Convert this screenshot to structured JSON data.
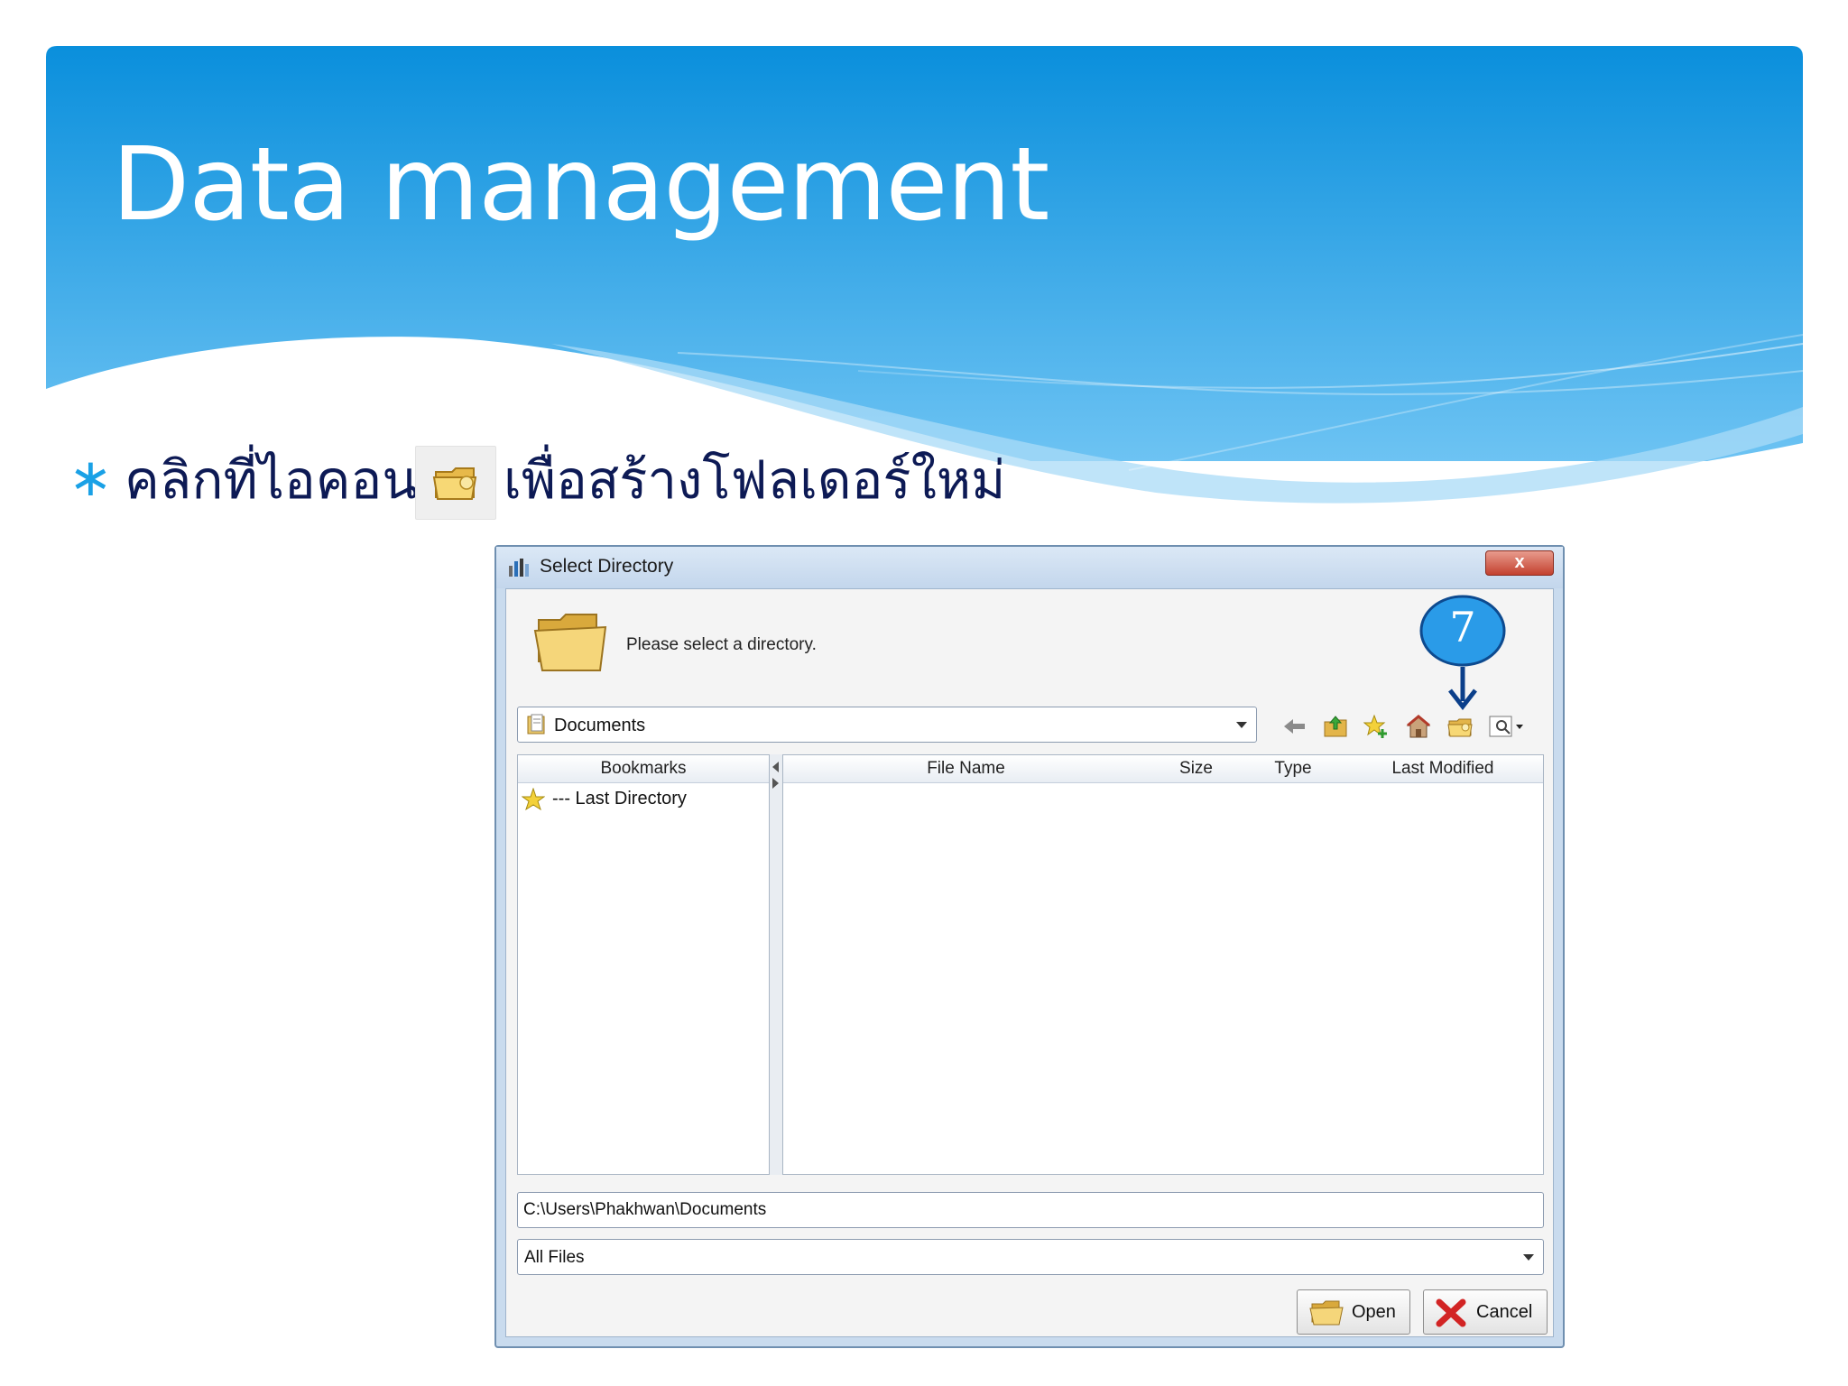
{
  "slide": {
    "title": "Data management",
    "bullet": {
      "text_before_icon": "คลิกที่ไอคอน",
      "text_after_icon": "เพื่อสร้างโฟลเดอร์ใหม่",
      "icon": "new-folder-icon"
    }
  },
  "dialog": {
    "title": "Select Directory",
    "close_label": "x",
    "prompt": "Please select a directory.",
    "step_badge": "7",
    "location": "Documents",
    "toolbar_icons": [
      "back-arrow-icon",
      "folder-up-icon",
      "add-bookmark-icon",
      "home-icon",
      "new-folder-icon",
      "view-details-icon"
    ],
    "bookmarks": {
      "header": "Bookmarks",
      "items": [
        "--- Last Directory"
      ]
    },
    "file_table": {
      "columns": [
        "File Name",
        "Size",
        "Type",
        "Last Modified"
      ]
    },
    "path": "C:\\Users\\Phakhwan\\Documents",
    "file_filter": "All Files",
    "buttons": {
      "open": "Open",
      "cancel": "Cancel"
    }
  },
  "colors": {
    "banner_top": "#0a8fdc",
    "banner_bottom": "#6dc3f3",
    "title_text": "#ffffff",
    "bullet_star": "#1aa1e6",
    "thai_text": "#0d1a55",
    "badge_fill": "#2a9be8",
    "badge_arrow": "#0b3f8a"
  }
}
